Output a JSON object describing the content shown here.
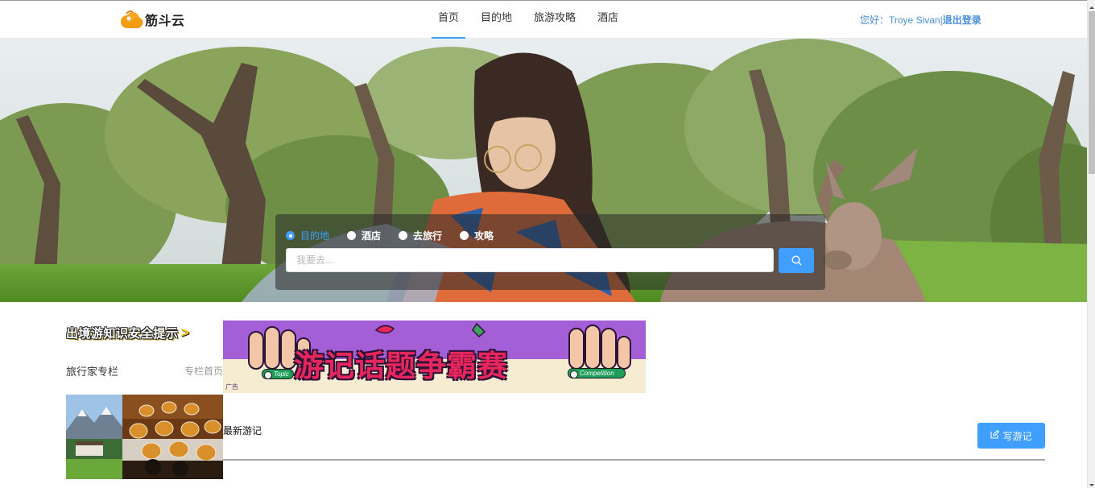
{
  "header": {
    "logo_text": "筋斗云",
    "nav": [
      {
        "label": "首页",
        "active": true
      },
      {
        "label": "目的地",
        "active": false
      },
      {
        "label": "旅游攻略",
        "active": false
      },
      {
        "label": "酒店",
        "active": false
      }
    ],
    "user_greeting": "您好：Troye Sivan",
    "separator": "|",
    "logout": "退出登录"
  },
  "search": {
    "options": [
      {
        "label": "目的地",
        "checked": true
      },
      {
        "label": "酒店",
        "checked": false
      },
      {
        "label": "去旅行",
        "checked": false
      },
      {
        "label": "攻略",
        "checked": false
      }
    ],
    "placeholder": "我要去...",
    "value": "",
    "button_icon": "search-icon"
  },
  "safety_notice": {
    "text": "出境游知识安全提示",
    "arrow": ">"
  },
  "columnist": {
    "title": "旅行家专栏",
    "home_link": "专栏首页"
  },
  "banner": {
    "title": "游记话题争霸赛",
    "pill_left": "Topic",
    "pill_right": "Competition",
    "ad_label": "广告"
  },
  "latest": {
    "title": "最新游记",
    "write_button": "写游记",
    "write_icon": "edit-icon"
  },
  "colors": {
    "accent": "#409eff",
    "user_link": "#4a90d9"
  }
}
